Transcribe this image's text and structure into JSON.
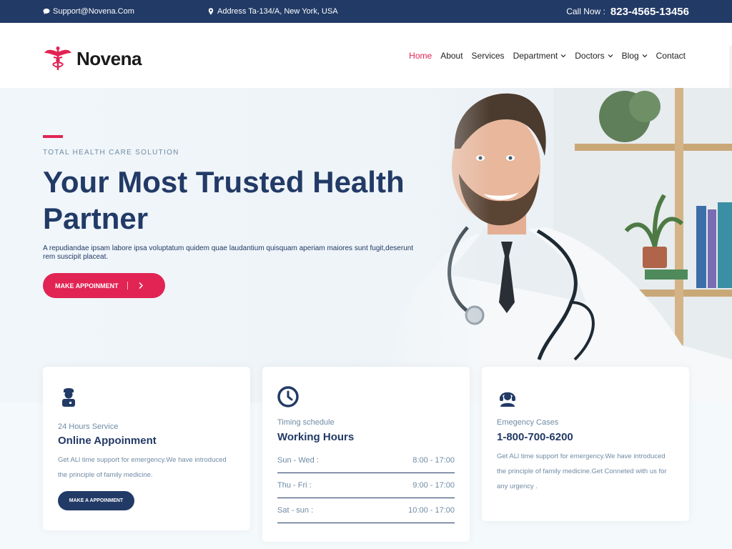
{
  "topbar": {
    "email": "Support@Novena.Com",
    "address": "Address Ta-134/A, New York, USA",
    "call_label": "Call Now :",
    "phone": "823-4565-13456"
  },
  "nav": {
    "brand": "Novena",
    "items": [
      {
        "label": "Home",
        "active": true
      },
      {
        "label": "About"
      },
      {
        "label": "Services"
      },
      {
        "label": "Department",
        "dropdown": true
      },
      {
        "label": "Doctors",
        "dropdown": true
      },
      {
        "label": "Blog",
        "dropdown": true
      },
      {
        "label": "Contact"
      }
    ]
  },
  "hero": {
    "eyebrow": "TOTAL HEALTH CARE SOLUTION",
    "headline_line1": "Your Most Trusted Health",
    "headline_line2": "Partner",
    "text": "A repudiandae ipsam labore ipsa voluptatum quidem quae laudantium quisquam aperiam maiores sunt fugit,deserunt rem suscipit placeat.",
    "button_label": "MAKE APPOINMENT"
  },
  "cards": {
    "service": {
      "icon": "doctor-icon",
      "small": "24 Hours Service",
      "title": "Online Appoinment",
      "body": "Get ALl time support for emergency.We have introduced the principle of family medicine.",
      "button_label": "MAKE A APPOINMENT"
    },
    "hours": {
      "icon": "clock-icon",
      "small": "Timing schedule",
      "title": "Working Hours",
      "rows": [
        {
          "day": "Sun - Wed :",
          "time": "8:00 - 17:00"
        },
        {
          "day": "Thu - Fri :",
          "time": "9:00 - 17:00"
        },
        {
          "day": "Sat - sun :",
          "time": "10:00 - 17:00"
        }
      ]
    },
    "emergency": {
      "icon": "headset-icon",
      "small": "Emegency Cases",
      "title": "1-800-700-6200",
      "body": "Get ALl time support for emergency.We have introduced the principle of family medicine.Get Conneted with us for any urgency ."
    }
  },
  "colors": {
    "navy": "#223a66",
    "accent": "#e12454",
    "muted": "#6f8ba4"
  }
}
